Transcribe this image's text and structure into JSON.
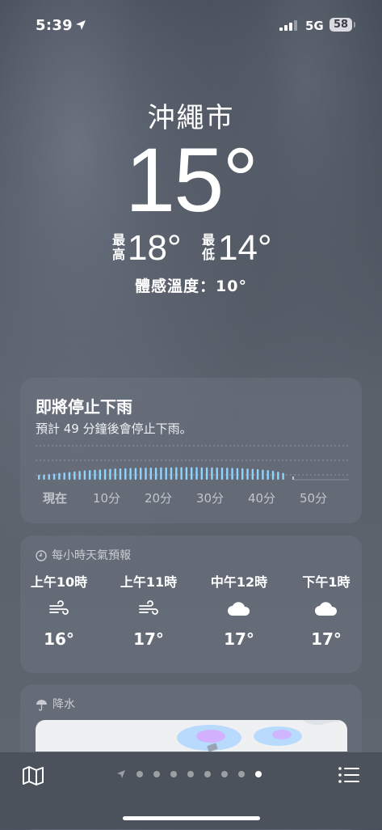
{
  "status": {
    "time": "5:39",
    "network": "5G",
    "battery": "58"
  },
  "location": {
    "city": "沖繩市"
  },
  "current": {
    "temp": "15°",
    "high_label": "最高",
    "high": "18°",
    "low_label": "最低",
    "low": "14°",
    "feels_like": "體感溫度：10°"
  },
  "rain_card": {
    "title": "即將停止下雨",
    "subtitle": "預計 49 分鐘後會停止下雨。",
    "chart_data": {
      "type": "bar",
      "x_labels": [
        "現在",
        "10分",
        "20分",
        "30分",
        "40分",
        "50分"
      ],
      "minutes_with_rain": 49,
      "intensity_relative": [
        0.3,
        0.32,
        0.35,
        0.38,
        0.42,
        0.45,
        0.48,
        0.52,
        0.55,
        0.58,
        0.6,
        0.62,
        0.64,
        0.66,
        0.68,
        0.7,
        0.71,
        0.72,
        0.73,
        0.74,
        0.75,
        0.75,
        0.76,
        0.76,
        0.77,
        0.77,
        0.77,
        0.78,
        0.78,
        0.78,
        0.78,
        0.78,
        0.77,
        0.77,
        0.77,
        0.76,
        0.76,
        0.75,
        0.74,
        0.73,
        0.72,
        0.7,
        0.68,
        0.66,
        0.63,
        0.6,
        0.56,
        0.5,
        0.42
      ]
    }
  },
  "hourly": {
    "header": "每小時天氣預報",
    "items": [
      {
        "time": "上午10時",
        "icon": "wind-icon",
        "temp": "16°"
      },
      {
        "time": "上午11時",
        "icon": "wind-icon",
        "temp": "17°"
      },
      {
        "time": "中午12時",
        "icon": "cloud-icon",
        "temp": "17°"
      },
      {
        "time": "下午1時",
        "icon": "cloud-icon",
        "temp": "17°"
      }
    ]
  },
  "precipitation": {
    "header": "降水"
  },
  "pager": {
    "page_count": 8,
    "active_index": 7
  },
  "colors": {
    "rain_bar": "#8fd3ff",
    "card_bg": "#5d6571",
    "rain_map_accent": "#6fb3ff"
  }
}
